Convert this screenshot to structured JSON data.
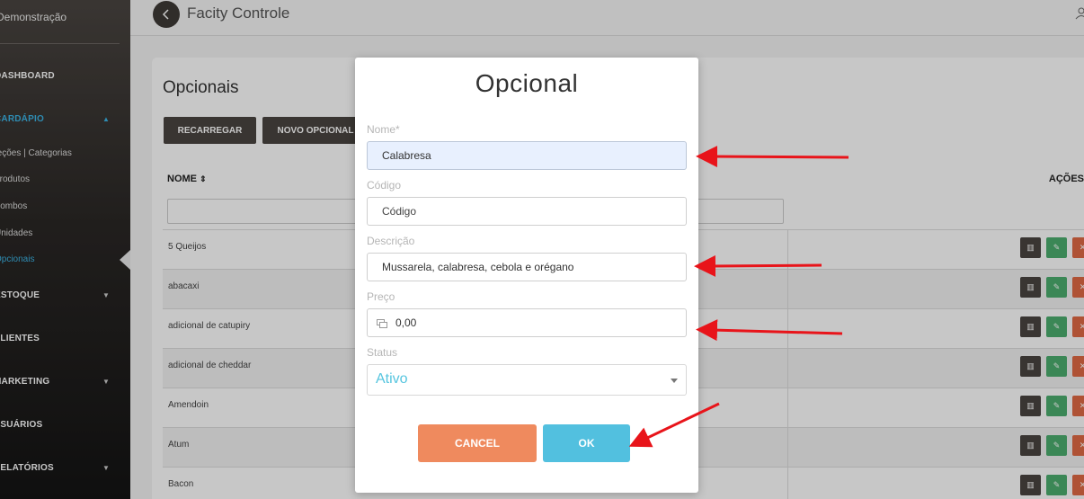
{
  "sidebar": {
    "company": "Demonstração",
    "items": [
      {
        "label": "DASHBOARD"
      },
      {
        "label": "CARDÁPIO"
      },
      {
        "label": "ESTOQUE"
      },
      {
        "label": "CLIENTES"
      },
      {
        "label": "MARKETING"
      },
      {
        "label": "USUÁRIOS"
      },
      {
        "label": "RELATÓRIOS"
      }
    ],
    "subitems": [
      {
        "label": "Seções | Categorias"
      },
      {
        "label": "Produtos"
      },
      {
        "label": "Combos"
      },
      {
        "label": "Unidades"
      },
      {
        "label": "Opcionais"
      }
    ]
  },
  "header": {
    "title": "Facity Controle"
  },
  "page": {
    "title": "Opcionais",
    "reload_label": "RECARREGAR",
    "new_label": "NOVO OPCIONAL",
    "col_name": "NOME",
    "col_actions": "AÇÕES",
    "rows": [
      "5 Queijos",
      "abacaxi",
      "adicional de catupiry",
      "adicional de cheddar",
      "Amendoin",
      "Atum",
      "Bacon"
    ]
  },
  "modal": {
    "title": "Opcional",
    "name_label": "Nome*",
    "name_value": "Calabresa",
    "code_label": "Código",
    "code_placeholder": "Código",
    "desc_label": "Descrição",
    "desc_value": "Mussarela, calabresa, cebola e orégano",
    "price_label": "Preço",
    "price_value": "0,00",
    "status_label": "Status",
    "status_value": "Ativo",
    "cancel_label": "CANCEL",
    "ok_label": "OK"
  },
  "colors": {
    "accent": "#3cb4e5",
    "cancel": "#ef8a5e",
    "ok": "#52c0df",
    "arrow": "#e8141a"
  }
}
